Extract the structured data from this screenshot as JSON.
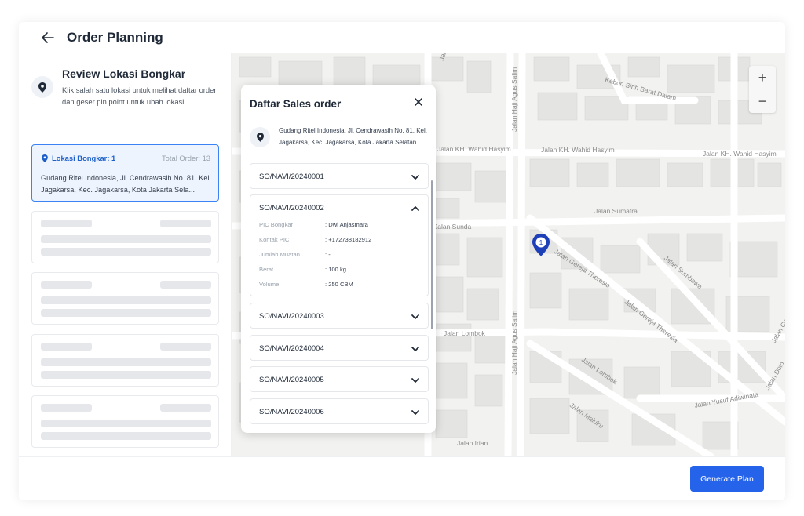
{
  "header": {
    "title": "Order Planning"
  },
  "sidebar": {
    "title": "Review Lokasi Bongkar",
    "description": "Klik salah satu lokasi untuk melihat daftar order dan geser pin point untuk ubah lokasi.",
    "location_card": {
      "label": "Lokasi Bongkar: 1",
      "total": "Total Order: 13",
      "address": "Gudang Ritel Indonesia, Jl. Cendrawasih No. 81, Kel. Jagakarsa, Kec. Jagakarsa, Kota Jakarta Sela..."
    }
  },
  "map": {
    "streets": [
      "Jalan KH. Wahid Hasyim",
      "Jalan KH. Wahid Hasyim",
      "Jalan KH. Wahid Hasyim",
      "Jalan Sumatra",
      "Jalan Sunda",
      "Jalan Gereja Theresia",
      "Jalan Gereja Theresia",
      "Jalan Sumbawa",
      "Jalan Lombok",
      "Jalan Lombok",
      "Jalan Haji Agus Salim",
      "Jalan Haji Agus Salim",
      "Jalan Yusuf Adiwinata",
      "Jalan Maluku",
      "Kebon Sirih Barat Dalam",
      "Jalan Kampung",
      "Jalan Cemara",
      "Jalan Dolo",
      "Jalan Irian"
    ],
    "pin_number": "1",
    "zoom_in": "+",
    "zoom_out": "−",
    "colors": {
      "pin": "#1d3fb8"
    }
  },
  "panel": {
    "title": "Daftar Sales order",
    "address": "Gudang Ritel Indonesia, Jl. Cendrawasih No. 81, Kel. Jagakarsa, Kec. Jagakarsa, Kota Jakarta Selatan",
    "orders": [
      {
        "id": "SO/NAVI/20240001"
      },
      {
        "id": "SO/NAVI/20240002"
      },
      {
        "id": "SO/NAVI/20240003"
      },
      {
        "id": "SO/NAVI/20240004"
      },
      {
        "id": "SO/NAVI/20240005"
      },
      {
        "id": "SO/NAVI/20240006"
      }
    ],
    "details": [
      {
        "key": "PIC Bongkar",
        "value": ": Dwi Anjasmara"
      },
      {
        "key": "Kontak PIC",
        "value": ": +172738182912"
      },
      {
        "key": "Jumlah Muatan",
        "value": ": -"
      },
      {
        "key": "Berat",
        "value": ": 100 kg"
      },
      {
        "key": "Volume",
        "value": ": 250 CBM"
      }
    ]
  },
  "footer": {
    "generate_label": "Generate Plan"
  },
  "colors": {
    "accent": "#2563eb",
    "card_bg": "#eef4fd"
  }
}
